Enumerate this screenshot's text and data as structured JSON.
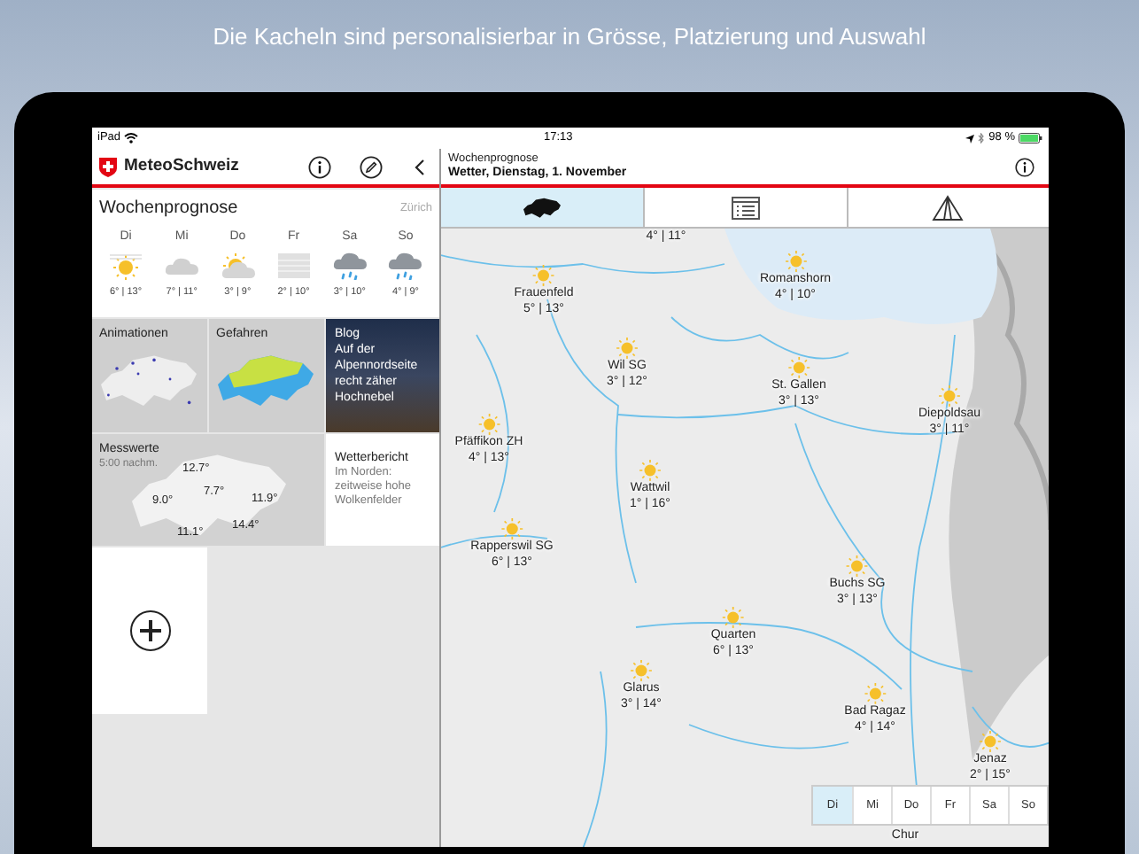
{
  "banner": "Die Kacheln sind personalisierbar in Grösse, Platzierung und Auswahl",
  "status_bar": {
    "device": "iPad",
    "time": "17:13",
    "battery": "98 %"
  },
  "sidebar": {
    "app_name": "MeteoSchweiz",
    "forecast": {
      "title": "Wochenprognose",
      "location": "Zürich",
      "days": [
        {
          "day": "Di",
          "kind": "sun-haze",
          "temps": "6° | 13°"
        },
        {
          "day": "Mi",
          "kind": "cloud",
          "temps": "7° | 11°"
        },
        {
          "day": "Do",
          "kind": "sun-cloud",
          "temps": "3° | 9°"
        },
        {
          "day": "Fr",
          "kind": "fog",
          "temps": "2° | 10°"
        },
        {
          "day": "Sa",
          "kind": "rain",
          "temps": "3° | 10°"
        },
        {
          "day": "So",
          "kind": "rain",
          "temps": "4° | 9°"
        }
      ]
    },
    "tiles": [
      {
        "kind": "radar",
        "title": "Animationen"
      },
      {
        "kind": "hazards",
        "title": "Gefahren"
      },
      {
        "kind": "blog",
        "title": "Blog",
        "text": "Auf der Alpennordseite recht zäher Hochnebel"
      },
      {
        "kind": "measurements",
        "title": "Messwerte",
        "subtitle": "5:00 nachm.",
        "values": [
          "12.7°",
          "7.7°",
          "9.0°",
          "11.9°",
          "11.1°",
          "14.4°"
        ]
      },
      {
        "kind": "report",
        "title": "Wetterbericht",
        "text": "Im Norden: zeitweise hohe Wolkenfelder"
      },
      {
        "kind": "add"
      }
    ]
  },
  "detail": {
    "subtitle": "Wochenprognose",
    "title": "Wetter, Dienstag, 1. November",
    "tabs": [
      {
        "kind": "map",
        "selected": true
      },
      {
        "kind": "list",
        "selected": false
      },
      {
        "kind": "warnings",
        "selected": false
      }
    ],
    "map": {
      "places": [
        {
          "kind": "temps",
          "temps": "4° | 11°"
        },
        {
          "kind": "sun",
          "name": "Frauenfeld",
          "temps": "5° | 13°"
        },
        {
          "kind": "sun",
          "name": "Romanshorn",
          "temps": "4° | 10°"
        },
        {
          "kind": "sun",
          "name": "Wil SG",
          "temps": "3° | 12°"
        },
        {
          "kind": "sun",
          "name": "St. Gallen",
          "temps": "3° | 13°"
        },
        {
          "kind": "sun",
          "name": "Diepoldsau",
          "temps": "3° | 11°"
        },
        {
          "kind": "sun",
          "name": "Pfäffikon ZH",
          "temps": "4° | 13°"
        },
        {
          "kind": "sun",
          "name": "Wattwil",
          "temps": "1° | 16°"
        },
        {
          "kind": "sun",
          "name": "Rapperswil SG",
          "temps": "6° | 13°"
        },
        {
          "kind": "sun",
          "name": "Buchs SG",
          "temps": "3° | 13°"
        },
        {
          "kind": "sun",
          "name": "Quarten",
          "temps": "6° | 13°"
        },
        {
          "kind": "sun",
          "name": "Glarus",
          "temps": "3° | 14°"
        },
        {
          "kind": "sun",
          "name": "Bad Ragaz",
          "temps": "4° | 14°"
        },
        {
          "kind": "sun",
          "name": "Jenaz",
          "temps": "2° | 15°"
        },
        {
          "kind": "label",
          "name": "Chur"
        }
      ]
    },
    "day_selector": [
      {
        "label": "Di",
        "selected": true
      },
      {
        "label": "Mi",
        "selected": false
      },
      {
        "label": "Do",
        "selected": false
      },
      {
        "label": "Fr",
        "selected": false
      },
      {
        "label": "Sa",
        "selected": false
      },
      {
        "label": "So",
        "selected": false
      }
    ]
  }
}
